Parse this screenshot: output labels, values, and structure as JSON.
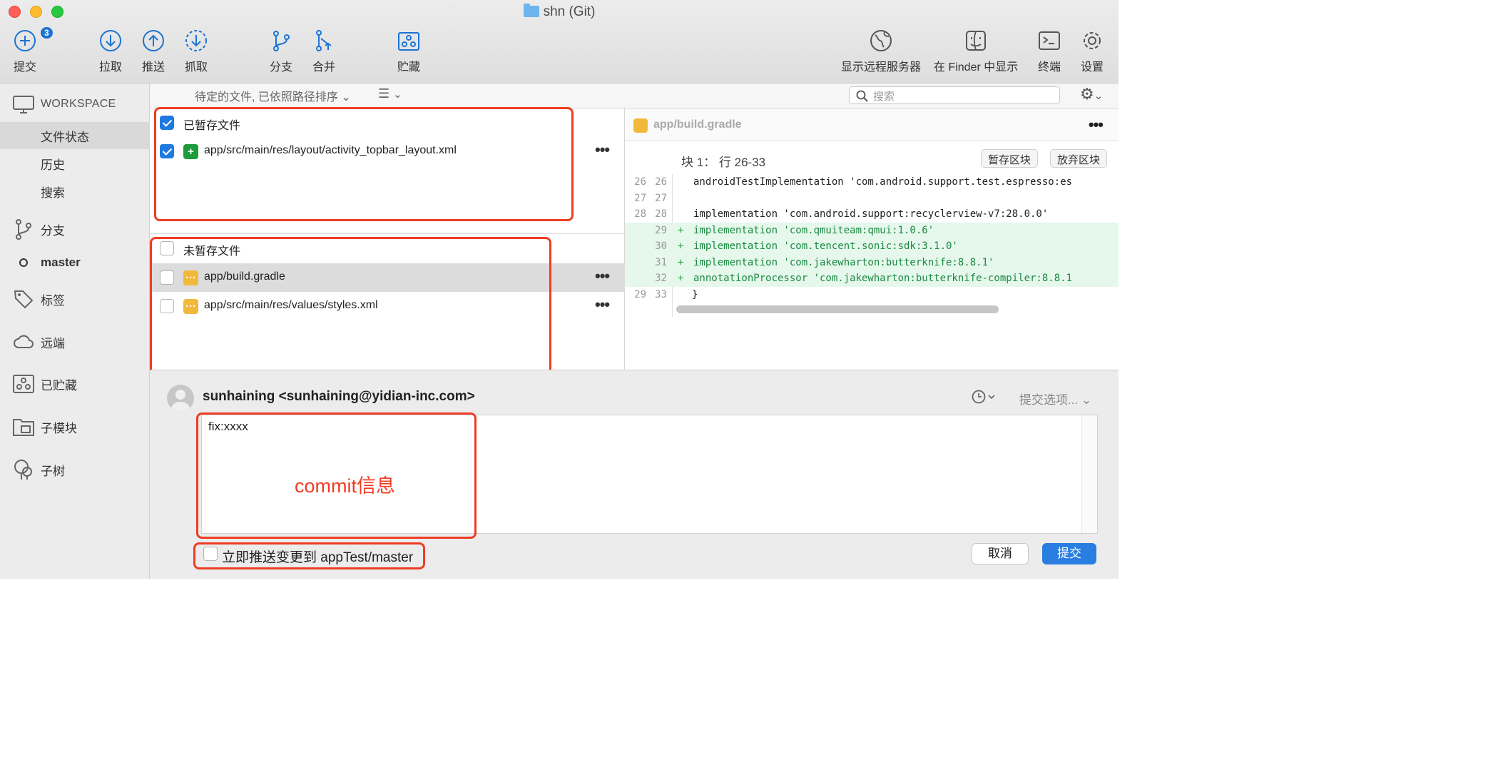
{
  "window": {
    "title": "shn (Git)"
  },
  "toolbar": {
    "commit": {
      "label": "提交",
      "badge": "3"
    },
    "pull": "拉取",
    "push": "推送",
    "fetch": "抓取",
    "branch": "分支",
    "merge": "合并",
    "stash": "贮藏",
    "remote_server": "显示远程服务器",
    "show_in_finder": "在 Finder 中显示",
    "terminal": "终端",
    "settings": "设置"
  },
  "sidebar": {
    "workspace": "WORKSPACE",
    "file_status": "文件状态",
    "history": "历史",
    "search": "搜索",
    "branches": "分支",
    "current_branch": "master",
    "tags": "标签",
    "remotes": "远端",
    "stashes": "已贮藏",
    "submodules": "子模块",
    "subtrees": "子树"
  },
  "filterbar": {
    "sort_label": "待定的文件, 已依照路径排序",
    "search_placeholder": "搜索"
  },
  "staged": {
    "header": "已暂存文件",
    "files": [
      {
        "path": "app/src/main/res/layout/activity_topbar_layout.xml",
        "status": "added"
      }
    ]
  },
  "unstaged": {
    "header": "未暂存文件",
    "files": [
      {
        "path": "app/build.gradle",
        "status": "modified"
      },
      {
        "path": "app/src/main/res/values/styles.xml",
        "status": "modified"
      }
    ]
  },
  "diff": {
    "file": "app/build.gradle",
    "hunk_title": "块 1： 行 26-33",
    "stage_hunk": "暂存区块",
    "discard_hunk": "放弃区块",
    "lines": [
      {
        "old": "26",
        "new": "26",
        "sign": "",
        "code": "androidTestImplementation 'com.android.support.test.espresso:es",
        "added": false
      },
      {
        "old": "27",
        "new": "27",
        "sign": "",
        "code": "",
        "added": false
      },
      {
        "old": "28",
        "new": "28",
        "sign": "",
        "code": "implementation 'com.android.support:recyclerview-v7:28.0.0'",
        "added": false
      },
      {
        "old": "",
        "new": "29",
        "sign": "+",
        "code": "implementation 'com.qmuiteam:qmui:1.0.6'",
        "added": true
      },
      {
        "old": "",
        "new": "30",
        "sign": "+",
        "code": "implementation 'com.tencent.sonic:sdk:3.1.0'",
        "added": true
      },
      {
        "old": "",
        "new": "31",
        "sign": "+",
        "code": "implementation 'com.jakewharton:butterknife:8.8.1'",
        "added": true
      },
      {
        "old": "",
        "new": "32",
        "sign": "+",
        "code": "annotationProcessor 'com.jakewharton:butterknife-compiler:8.8.1",
        "added": true
      },
      {
        "old": "29",
        "new": "33",
        "sign": "",
        "code": "}",
        "added": false
      }
    ]
  },
  "commit": {
    "author": "sunhaining <sunhaining@yidian-inc.com>",
    "options": "提交选项...",
    "message": "fix:xxxx",
    "annotation": "commit信息",
    "push_label": "立即推送变更到 appTest/master",
    "cancel": "取消",
    "submit": "提交"
  }
}
